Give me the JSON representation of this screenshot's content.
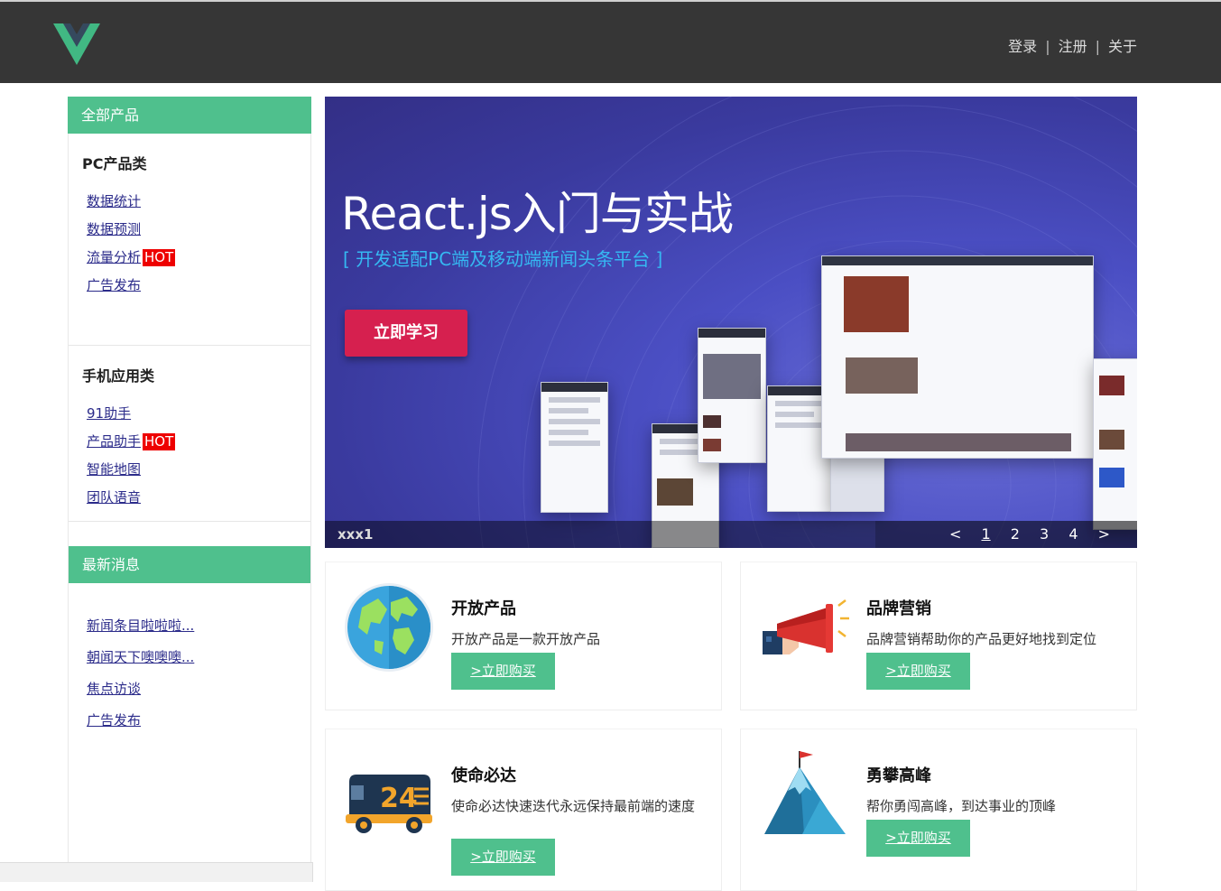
{
  "header": {
    "nav": [
      "登录",
      "注册",
      "关于"
    ],
    "separator": "|"
  },
  "sidebar": {
    "title": "全部产品",
    "categories": [
      {
        "title": "PC产品类",
        "items": [
          {
            "label": "数据统计",
            "hot": false
          },
          {
            "label": "数据预测",
            "hot": false
          },
          {
            "label": "流量分析",
            "hot": true
          },
          {
            "label": "广告发布",
            "hot": false
          }
        ]
      },
      {
        "title": "手机应用类",
        "items": [
          {
            "label": "91助手",
            "hot": false
          },
          {
            "label": "产品助手",
            "hot": true
          },
          {
            "label": "智能地图",
            "hot": false
          },
          {
            "label": "团队语音",
            "hot": false
          }
        ]
      }
    ],
    "hot_label": "HOT"
  },
  "news": {
    "title": "最新消息",
    "items": [
      "新闻条目啦啦啦...",
      "朝闻天下噢噢噢...",
      "焦点访谈",
      "广告发布"
    ]
  },
  "banner": {
    "title": "React.js入门与实战",
    "subtitle": "[ 开发适配PC端及移动端新闻头条平台 ]",
    "button": "立即学习",
    "caption": "xxx1",
    "pager": [
      "<",
      "1",
      "2",
      "3",
      "4",
      ">"
    ],
    "active_page": "1"
  },
  "products": [
    {
      "title": "开放产品",
      "desc": "开放产品是一款开放产品",
      "button": ">立即购买",
      "icon": "globe-icon"
    },
    {
      "title": "品牌营销",
      "desc": "品牌营销帮助你的产品更好地找到定位",
      "button": ">立即购买",
      "icon": "megaphone-icon"
    },
    {
      "title": "使命必达",
      "desc": "使命必达快速迭代永远保持最前端的速度",
      "button": ">立即购买",
      "icon": "delivery-truck-icon"
    },
    {
      "title": "勇攀高峰",
      "desc": "帮你勇闯高峰，到达事业的顶峰",
      "button": ">立即购买",
      "icon": "mountain-flag-icon"
    }
  ],
  "colors": {
    "header_bg": "#363636",
    "accent": "#4fc08d",
    "hot": "#ee0000",
    "banner_button": "#d6204f"
  }
}
